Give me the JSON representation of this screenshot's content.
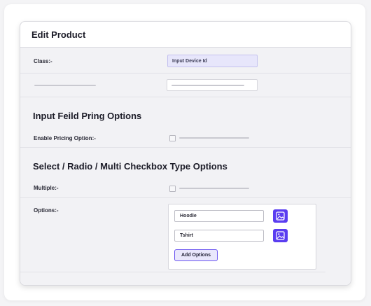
{
  "header": {
    "title": "Edit Product"
  },
  "fields": {
    "class_label": "Class:-",
    "class_value": "Input Device Id"
  },
  "pricing_section": {
    "title": "Input Feild Pring Options",
    "enable_label": "Enable Pricing Option:-"
  },
  "select_section": {
    "title": "Select / Radio / Multi Checkbox Type Options",
    "multiple_label": "Multiple:-",
    "options_label": "Options:-",
    "options": [
      {
        "value": "Hoodie",
        "icon": "image-icon"
      },
      {
        "value": "Tshirt",
        "icon": "image-icon"
      }
    ],
    "add_label": "Add Options"
  },
  "colors": {
    "accent": "#5a3df0",
    "chip_bg": "#e7e6fb"
  }
}
